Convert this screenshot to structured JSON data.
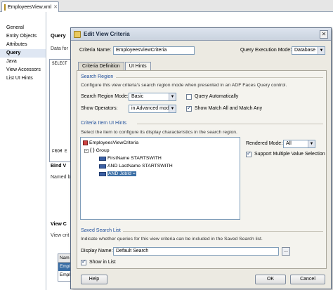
{
  "ide": {
    "tab_label": "EmployeesView.xml",
    "nav_items": [
      "General",
      "Entity Objects",
      "Attributes",
      "Query",
      "Java",
      "View Accessors",
      "List UI Hints"
    ],
    "active_nav": "Query",
    "main_title": "Query",
    "main_data_label": "Data for",
    "sql_line1": "SELECT",
    "sql_line2": "FROM E",
    "bind_title": "Bind V",
    "bind_sub": "Named b",
    "view_title": "View C",
    "view_sub": "View crit",
    "mini_table_header": "Nam",
    "mini_table_rows": [
      "Emplo",
      "Emplo"
    ]
  },
  "dialog": {
    "title": "Edit View Criteria",
    "criteria_name_label": "Criteria Name:",
    "criteria_name_value": "EmployeesViewCriteria",
    "query_mode_label": "Query Execution Mode:",
    "query_mode_value": "Database",
    "tabs": [
      "Criteria Definition",
      "UI Hints"
    ],
    "active_tab": "UI Hints",
    "search_region": {
      "header": "Search Region",
      "description": "Configure this view criteria's search region mode when presented in an ADF Faces Query control.",
      "mode_label": "Search Region Mode:",
      "mode_value": "Basic",
      "query_auto_label": "Query Automatically",
      "query_auto_checked": false,
      "show_ops_label": "Show Operators:",
      "show_ops_value": "in Advanced mode",
      "show_match_label": "Show Match All and Match Any",
      "show_match_checked": true
    },
    "criteria_item": {
      "header": "Criteria Item UI Hints",
      "description": "Select the item to configure its display characteristics in the search region.",
      "tree": {
        "root": "EmployeesViewCriteria",
        "group": "Group",
        "items": [
          "FirstName STARTSWITH",
          "AND LastName STARTSWITH",
          "AND JobId ="
        ],
        "selected": "AND JobId ="
      },
      "rendered_mode_label": "Rendered Mode:",
      "rendered_mode_value": "All",
      "support_multi_label": "Support Multiple Value Selection",
      "support_multi_checked": true
    },
    "saved_search": {
      "header": "Saved Search List",
      "description": "Indicate whether queries for this view criteria can be included in the Saved Search list.",
      "display_name_label": "Display Name:",
      "display_name_value": "Default Search",
      "browse_label": "...",
      "show_in_list_label": "Show in List",
      "show_in_list_checked": true
    },
    "buttons": {
      "help": "Help",
      "ok": "OK",
      "cancel": "Cancel"
    }
  }
}
